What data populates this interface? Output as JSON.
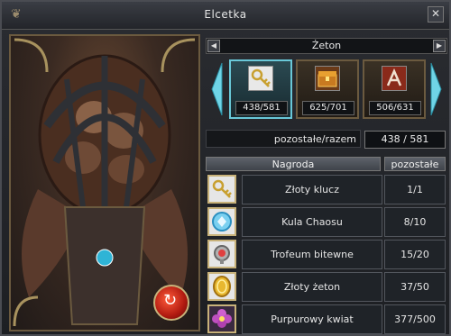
{
  "window": {
    "title": "Elcetka",
    "close_glyph": "✕"
  },
  "selector": {
    "label": "Żeton",
    "left_icon": "triangle-left-icon",
    "right_icon": "triangle-right-icon"
  },
  "tokens": [
    {
      "icon": "golden-key-icon",
      "count": "438/581",
      "active": true
    },
    {
      "icon": "treasure-chest-icon",
      "count": "625/701",
      "active": false
    },
    {
      "icon": "rune-scroll-icon",
      "count": "506/631",
      "active": false
    }
  ],
  "remaining": {
    "label": "pozostałe/razem",
    "value": "438 / 581"
  },
  "table": {
    "headers": {
      "reward": "Nagroda",
      "left": "pozostałe"
    },
    "rows": [
      {
        "icon": "golden-key-icon",
        "name": "Złoty klucz",
        "qty": "1/1"
      },
      {
        "icon": "chaos-orb-icon",
        "name": "Kula Chaosu",
        "qty": "8/10"
      },
      {
        "icon": "battle-trophy-icon",
        "name": "Trofeum bitewne",
        "qty": "15/20"
      },
      {
        "icon": "gold-coin-icon",
        "name": "Złoty żeton",
        "qty": "37/50"
      },
      {
        "icon": "purple-flower-icon",
        "name": "Purpurowy kwiat",
        "qty": "377/500"
      }
    ]
  },
  "colors": {
    "accent": "#69c8d8",
    "frame": "#6b5a3f",
    "gold": "#c8b27a"
  }
}
